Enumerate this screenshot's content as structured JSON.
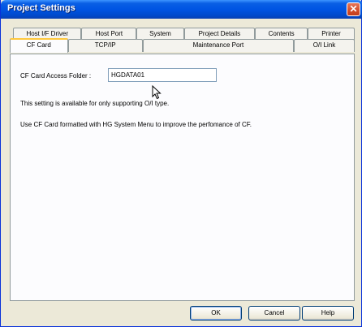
{
  "window": {
    "title": "Project Settings",
    "close_icon": "close-icon"
  },
  "tabs": {
    "back_row": [
      "Host I/F Driver",
      "Host Port",
      "System",
      "Project Details",
      "Contents",
      "Printer"
    ],
    "front_row": [
      "CF Card",
      "TCP/IP",
      "Maintenance Port",
      "O/I Link"
    ],
    "active": "CF Card"
  },
  "cf_card": {
    "folder_label": "CF Card Access Folder :",
    "folder_value": "HGDATA01",
    "note_support": "This setting is available for only supporting O/I type.",
    "note_format": "Use CF Card formatted with HG System Menu to improve the perfomance of CF."
  },
  "buttons": {
    "ok": "OK",
    "cancel": "Cancel",
    "help": "Help"
  }
}
